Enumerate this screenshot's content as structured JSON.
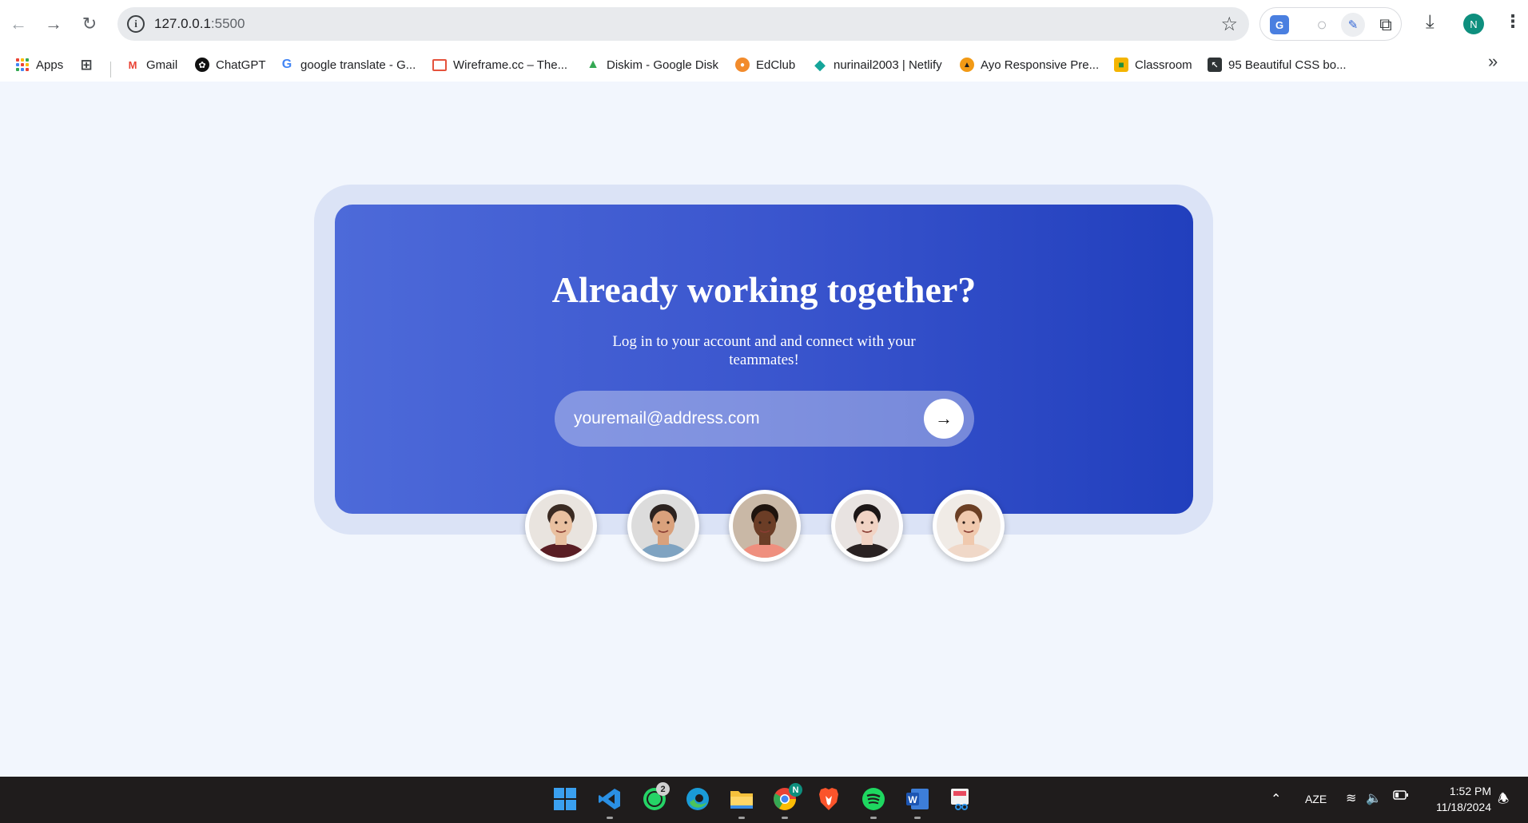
{
  "browser": {
    "url_host": "127.0.0.1",
    "url_port": ":5500",
    "profile_initial": "N"
  },
  "bookmarks": [
    {
      "label": "Apps",
      "icon": "apps-grid-icon"
    },
    {
      "label": "Gmail",
      "icon": "gmail-icon"
    },
    {
      "label": "ChatGPT",
      "icon": "chatgpt-icon"
    },
    {
      "label": "google translate - G...",
      "icon": "google-icon"
    },
    {
      "label": "Wireframe.cc – The...",
      "icon": "wireframe-icon"
    },
    {
      "label": "Diskim - Google Disk",
      "icon": "google-drive-icon"
    },
    {
      "label": "EdClub",
      "icon": "edclub-icon"
    },
    {
      "label": "nurinail2003 | Netlify",
      "icon": "netlify-icon"
    },
    {
      "label": "Ayo Responsive Pre...",
      "icon": "ayo-icon"
    },
    {
      "label": "Classroom",
      "icon": "classroom-icon"
    },
    {
      "label": "95 Beautiful CSS bo...",
      "icon": "css-icon"
    }
  ],
  "hero": {
    "title": "Already working together?",
    "subtitle": "Log in to your account and and connect with your teammates!",
    "email_placeholder": "youremail@address.com",
    "submit_icon": "arrow-right-icon"
  },
  "avatars": [
    {
      "name": "avatar-man-beard",
      "skin": "#e9c0a0",
      "hair": "#3a2a22",
      "shirt": "#5a1e24",
      "bg": "#e9e4df"
    },
    {
      "name": "avatar-man-smiling",
      "skin": "#d9a17c",
      "hair": "#2c2320",
      "shirt": "#7fa3c1",
      "bg": "#dcdcdc"
    },
    {
      "name": "avatar-girl-child",
      "skin": "#6b3d26",
      "hair": "#1e130d",
      "shirt": "#ef8f7e",
      "bg": "#c9b8a6"
    },
    {
      "name": "avatar-woman-dark-hair",
      "skin": "#f1d3c4",
      "hair": "#1c1616",
      "shirt": "#2a2222",
      "bg": "#e8e3e1"
    },
    {
      "name": "avatar-woman-smiling",
      "skin": "#f0c9ae",
      "hair": "#6b3f24",
      "shirt": "#f0d8c8",
      "bg": "#f0ebe6"
    }
  ],
  "taskbar": {
    "whatsapp_badge": "2",
    "chrome_badge": "N",
    "language": "AZE",
    "time": "1:52 PM",
    "date": "11/18/2024"
  },
  "colors": {
    "page_bg": "#f2f6fd",
    "card_outer": "#dbe3f6",
    "card_gradient_start": "#4d6ad9",
    "card_gradient_end": "#213fbd"
  }
}
